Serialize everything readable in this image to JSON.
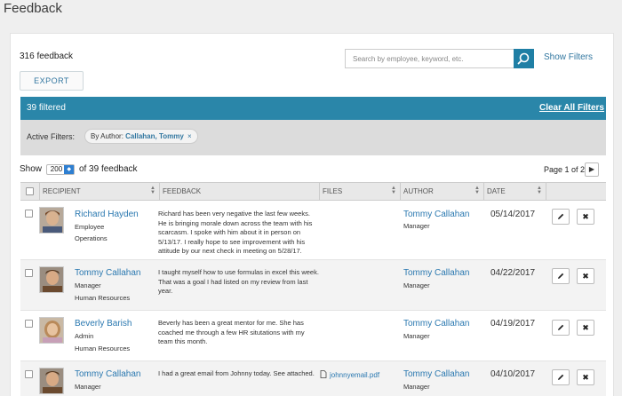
{
  "page": {
    "title": "Feedback"
  },
  "summary": {
    "count": "316 feedback"
  },
  "toolbar": {
    "export_label": "EXPORT",
    "search_placeholder": "Search by employee, keyword, etc.",
    "show_filters": "Show Filters"
  },
  "filter_bar": {
    "filtered": "39 filtered",
    "clear_all": "Clear All Filters"
  },
  "active_filters": {
    "label": "Active Filters:",
    "chip_prefix": "By Author:",
    "chip_value": "Callahan, Tommy",
    "chip_remove": "×"
  },
  "pagination": {
    "show_label": "Show",
    "per_page": "200",
    "of_label": "of 39 feedback",
    "page_label": "Page 1 of 2",
    "next": "▶"
  },
  "table": {
    "columns": [
      "RECIPIENT",
      "FEEDBACK",
      "FILES",
      "AUTHOR",
      "DATE"
    ],
    "rows": [
      {
        "recipient": "Richard Hayden",
        "title": "Employee",
        "dept": "Operations",
        "feedback": "Richard has been very negative the last few weeks. He is bringing morale down across the team with his scarcasm. I spoke with him about it in person on 5/13/17. I really hope to see improvement with his attitude by our next check in meeting on 5/28/17.",
        "file": "",
        "author": "Tommy Callahan",
        "author_role": "Manager",
        "date": "05/14/2017"
      },
      {
        "recipient": "Tommy Callahan",
        "title": "Manager",
        "dept": "Human Resources",
        "feedback": "I taught myself how to use formulas in excel this week. That was a goal I had listed on my review from last year.",
        "file": "",
        "author": "Tommy Callahan",
        "author_role": "Manager",
        "date": "04/22/2017"
      },
      {
        "recipient": "Beverly Barish",
        "title": "Admin",
        "dept": "Human Resources",
        "feedback": "Beverly has been a great mentor for me. She has coached me through a few HR situtations with my team this month.",
        "file": "",
        "author": "Tommy Callahan",
        "author_role": "Manager",
        "date": "04/19/2017"
      },
      {
        "recipient": "Tommy Callahan",
        "title": "Manager",
        "dept": "",
        "feedback": "I had a great email from Johnny today. See attached.",
        "file": "johnnyemail.pdf",
        "author": "Tommy Callahan",
        "author_role": "Manager",
        "date": "04/10/2017"
      }
    ]
  },
  "actions": {
    "edit_icon": "pencil-icon",
    "delete_icon": "close-icon"
  },
  "colors": {
    "accent": "#2a86a9",
    "link": "#2a78b0",
    "filters_bg": "#dcdcdc"
  }
}
